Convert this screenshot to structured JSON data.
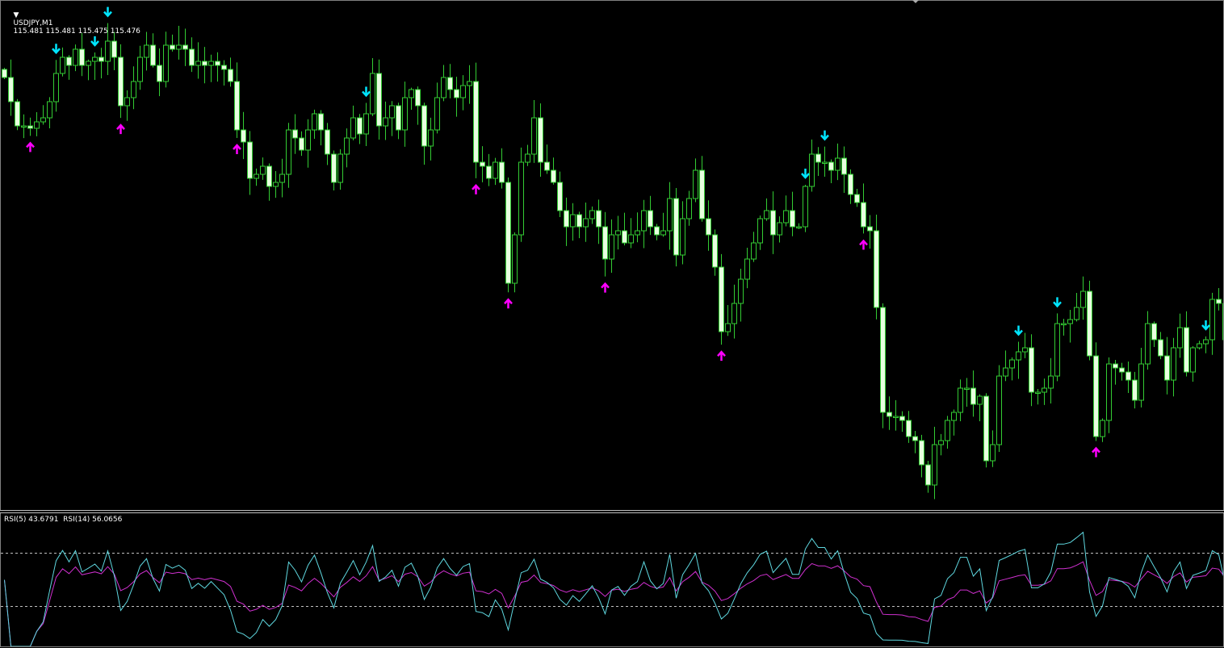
{
  "header": {
    "symbol_timeframe": "USDJPY,M1",
    "ohlc": "115.481 115.481 115.475 115.476"
  },
  "chart_data": {
    "type": "candlestick",
    "symbol": "USDJPY",
    "timeframe": "M1",
    "base_price": 115.476,
    "point": 0.001,
    "close_points": [
      65,
      59,
      53,
      53,
      52.4,
      54,
      55,
      59,
      66,
      70,
      68,
      72,
      68,
      69,
      70,
      69,
      74,
      70,
      58,
      60,
      64,
      70,
      73,
      68,
      64,
      73,
      72,
      73,
      72,
      68,
      69,
      68,
      69,
      68,
      67,
      64,
      52,
      49,
      40,
      41,
      43,
      38,
      39,
      41,
      52,
      50,
      47,
      52,
      56,
      52,
      46,
      39,
      46,
      50,
      55,
      51,
      56,
      66,
      53,
      55,
      58,
      52,
      60,
      62,
      58,
      48,
      52,
      60,
      65,
      62,
      60,
      63,
      64,
      44,
      43,
      40,
      44,
      39,
      14,
      26,
      44,
      46,
      55,
      44,
      42,
      39,
      32,
      28,
      31,
      28,
      30,
      32,
      28,
      20,
      26,
      27,
      24,
      26,
      27,
      32,
      28,
      26,
      27,
      35,
      21,
      30,
      35,
      42,
      30,
      26,
      18,
      2,
      4,
      9,
      15,
      20,
      24,
      30,
      32,
      26,
      29,
      32,
      28,
      28,
      38,
      46,
      44,
      44,
      42,
      45,
      41,
      36,
      34,
      28,
      27,
      8,
      -18,
      -19,
      -19,
      -20,
      -24,
      -25,
      -31,
      -36,
      -26,
      -25,
      -20,
      -18,
      -12,
      -12,
      -16,
      -14,
      -30,
      -26,
      -9,
      -7,
      -5,
      -3,
      -2,
      -13,
      -13,
      -12,
      -9,
      4,
      4,
      5,
      8,
      12,
      -4,
      -24,
      -20,
      -6,
      -7,
      -8,
      -10,
      -15,
      -6,
      4,
      0,
      -4,
      -10,
      -2,
      3,
      -8,
      -2,
      -1,
      0,
      10,
      9,
      0
    ],
    "signals": {
      "sell": [
        8,
        14,
        16,
        56,
        124,
        127,
        157,
        163,
        186
      ],
      "buy": [
        4,
        18,
        36,
        73,
        78,
        93,
        111,
        133,
        169
      ]
    },
    "colors": {
      "candle": "#33cc33",
      "bear_fill": "#e8ffe0",
      "bull_fill": "#000000",
      "sell_arrow": "#00e5ff",
      "buy_arrow": "#ff00ff"
    }
  },
  "rsi_panel": {
    "label": "RSI(5) 43.6791  RSI(14) 56.0656",
    "periods": [
      5,
      14
    ],
    "levels": [
      70,
      30
    ],
    "range": [
      0,
      100
    ],
    "colors": {
      "rsi_fast": "#5fd8e0",
      "rsi_slow": "#d030d0",
      "levels": "#c0c0c0"
    }
  }
}
